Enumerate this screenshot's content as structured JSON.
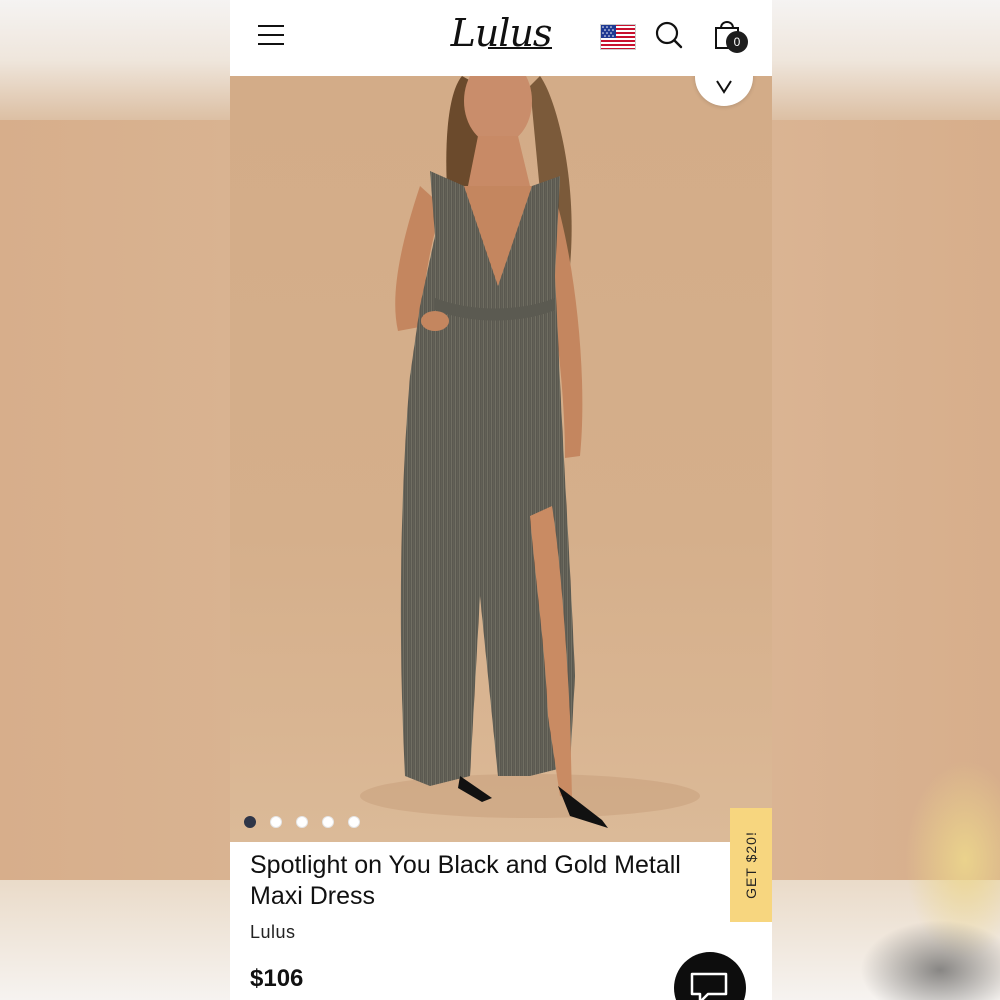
{
  "header": {
    "logo_text": "Lulus",
    "cart_count": "0",
    "icons": [
      "hamburger-menu-icon",
      "us-flag-icon",
      "search-icon",
      "shopping-bag-icon"
    ]
  },
  "gallery": {
    "image_alt": "Model wearing black and gold metallic maxi dress",
    "total_images": 5,
    "active_index": 0
  },
  "promo": {
    "label": "GET $20!"
  },
  "product": {
    "title_line1": "Spotlight on You Black and Gold Metall",
    "title_line2": "Maxi Dress",
    "brand": "Lulus",
    "price": "$106"
  },
  "colors": {
    "backdrop": "#d8b292",
    "promo_tab": "#f7d67f",
    "active_dot": "#2f3648",
    "chat_button": "#0d0d0d"
  }
}
